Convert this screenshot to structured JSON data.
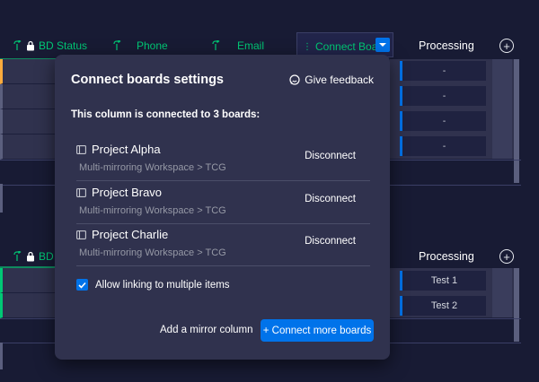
{
  "board_top": {
    "columns": {
      "bd_status": "BD Status",
      "phone": "Phone",
      "email": "Email",
      "connect_boards": "Connect Boa...",
      "processing": "Processing"
    },
    "processing_values": [
      "-",
      "-",
      "-",
      "-"
    ]
  },
  "board_bottom": {
    "columns": {
      "bd_status": "BD",
      "processing": "Processing"
    },
    "processing_values": [
      "Test 1",
      "Test 2"
    ]
  },
  "popup": {
    "title": "Connect boards settings",
    "feedback_label": "Give feedback",
    "subtitle": "This column is connected to 3 boards:",
    "boards": [
      {
        "name": "Project Alpha",
        "path": "Multi-mirroring Workspace > TCG",
        "action": "Disconnect"
      },
      {
        "name": "Project Bravo",
        "path": "Multi-mirroring Workspace > TCG",
        "action": "Disconnect"
      },
      {
        "name": "Project Charlie",
        "path": "Multi-mirroring Workspace > TCG",
        "action": "Disconnect"
      }
    ],
    "allow_multiple_label": "Allow linking to multiple items",
    "allow_multiple_checked": true,
    "mirror_label": "Add a mirror column",
    "connect_more_label": "+ Connect more boards"
  },
  "colors": {
    "background": "#181b34",
    "panel": "#30324e",
    "accent": "#0073ea",
    "status_green": "#00c875"
  }
}
